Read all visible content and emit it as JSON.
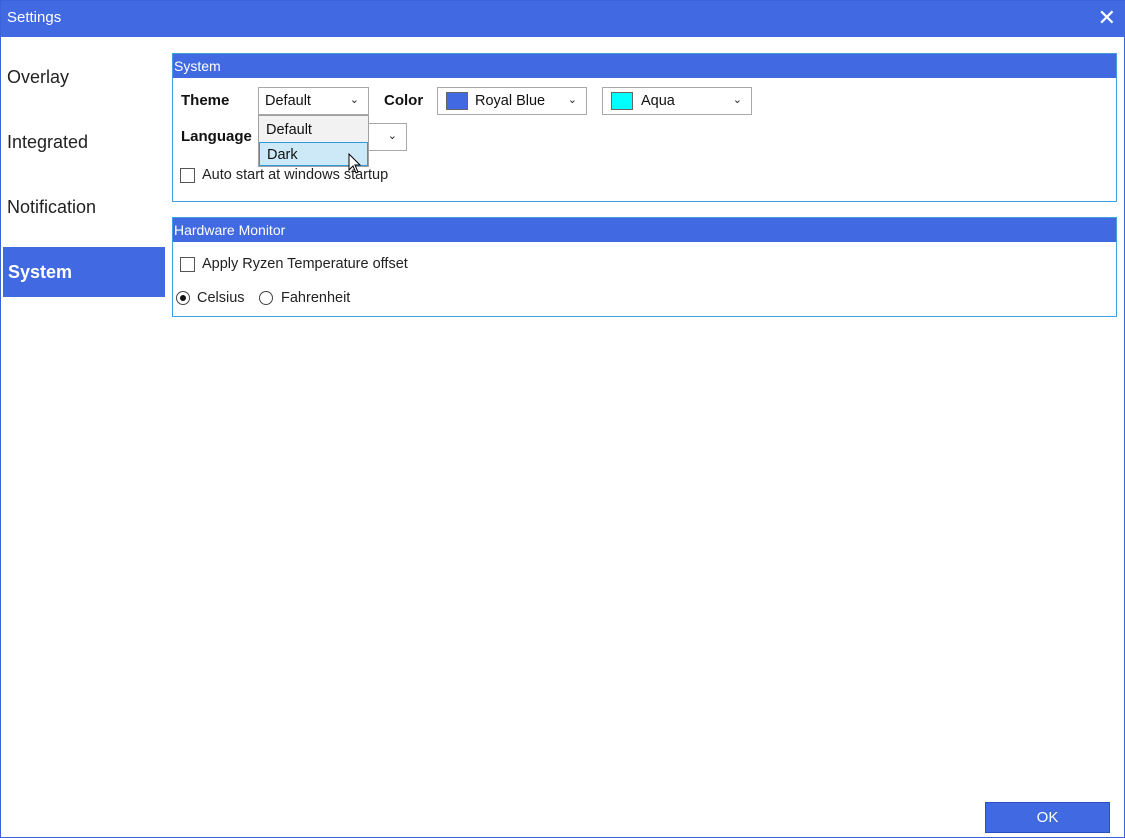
{
  "window": {
    "title": "Settings",
    "close_glyph": "✕"
  },
  "nav": {
    "items": [
      "Overlay",
      "Integrated",
      "Notification"
    ],
    "active": "System"
  },
  "system_group": {
    "header": "System",
    "theme_label": "Theme",
    "theme_value": "Default",
    "theme_options": [
      "Default",
      "Dark"
    ],
    "color_label": "Color",
    "color_value": "Royal Blue",
    "color_swatch": "#4169e1",
    "color2_value": "Aqua",
    "color2_swatch": "#00ffff",
    "language_label": "Language",
    "autostart_label": "Auto start at windows startup"
  },
  "hardware_group": {
    "header": "Hardware Monitor",
    "ryzen_label": "Apply Ryzen Temperature offset",
    "celsius_label": "Celsius",
    "fahrenheit_label": "Fahrenheit",
    "selected_unit": "Celsius"
  },
  "footer": {
    "ok_label": "OK"
  },
  "theme": {
    "accent": "#4169e1",
    "group_border": "#3fa0e0",
    "highlight": "#cde8f6"
  },
  "icons": {
    "close": "close-icon",
    "chevron": "chevron-down-icon",
    "cursor": "mouse-pointer-icon"
  }
}
